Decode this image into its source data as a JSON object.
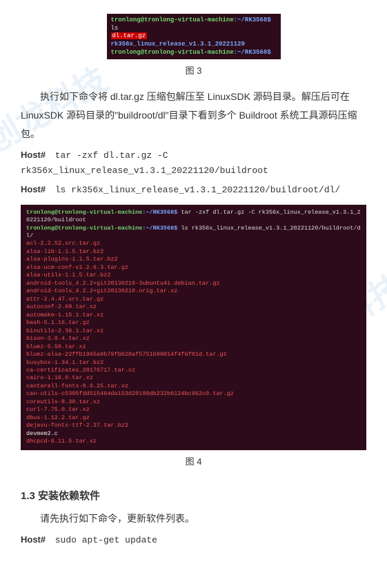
{
  "watermark": "创龙科技",
  "fig3": {
    "caption": "图 3",
    "lines": [
      {
        "user": "tronlong@tronlong-virtual-machine",
        "path": ":~/RK3568$",
        "cmd": " ls"
      },
      {
        "files": [
          {
            "t": "dl.tar.gz",
            "c": "hl-red"
          },
          {
            "t": "  rk356x_linux_release_v1.3.1_20221120",
            "c": "prompt-path"
          }
        ]
      },
      {
        "user": "tronlong@tronlong-virtual-machine",
        "path": ":~/RK3568$",
        "cmd": ""
      }
    ]
  },
  "para1": "执行如下命令将 dl.tar.gz 压缩包解压至 LinuxSDK 源码目录。解压后可在 LinuxSDK 源码目录的\"buildroot/dl\"目录下看到多个 Buildroot 系统工具源码压缩包。",
  "cmd1": {
    "label": "Host#",
    "text": "tar  -zxf  dl.tar.gz  -C  rk356x_linux_release_v1.3.1_20221120/buildroot"
  },
  "cmd2": {
    "label": "Host#",
    "text": "ls  rk356x_linux_release_v1.3.1_20221120/buildroot/dl/"
  },
  "fig4": {
    "caption": "图 4",
    "header": [
      {
        "user": "tronlong@tronlong-virtual-machine",
        "path": ":~/RK3568$",
        "cmd": " tar -zxf dl.tar.gz -C rk356x_linux_release_v1.3.1_20221120/buildroot"
      },
      {
        "user": "tronlong@tronlong-virtual-machine",
        "path": ":~/RK3568$",
        "cmd": " ls rk356x_linux_release_v1.3.1_20221120/buildroot/dl/"
      }
    ],
    "files": [
      "acl-2.2.52.src.tar.gz",
      "alsa-lib-1.1.5.tar.bz2",
      "alsa-plugins-1.1.5.tar.bz2",
      "alsa-ucm-conf-v1.2.6.3.tar.gz",
      "alsa-utils-1.1.5.tar.bz2",
      "android-tools_4.2.2+git20130218-3ubuntu41.debian.tar.gz",
      "android-tools_4.2.2+git20130218.orig.tar.xz",
      "attr-2.4.47.src.tar.gz",
      "autoconf-2.69.tar.xz",
      "automake-1.15.1.tar.xz",
      "bash-5.1.16.tar.gz",
      "binutils-2.36.1.tar.xz",
      "bison-3.0.4.tar.xz",
      "bluez-5.50.tar.xz",
      "bluez-alsa-22ffb1965a0b79fbb28af5751b98814f4f6f01d.tar.gz",
      "busybox-1.34.1.tar.bz2",
      "ca-certificates_20170717.tar.xz",
      "cairo-1.16.0.tar.xz",
      "cantarell-fonts-0.0.25.tar.xz",
      "can-utils-c5305fdd515464da153d20199db232b6124bc962c0.tar.gz",
      "coreutils-8.30.tar.xz",
      "curl-7.75.0.tar.xz",
      "dbus-1.12.2.tar.gz",
      "dejavu-fonts-ttf-2.37.tar.bz2"
    ],
    "whitefile": "devmem2.c",
    "lastfile": "dhcpcd-6.11.5.tar.xz"
  },
  "section": "1.3  安装依赖软件",
  "para2": "请先执行如下命令，更新软件列表。",
  "cmd3": {
    "label": "Host#",
    "text": "sudo  apt-get  update"
  }
}
